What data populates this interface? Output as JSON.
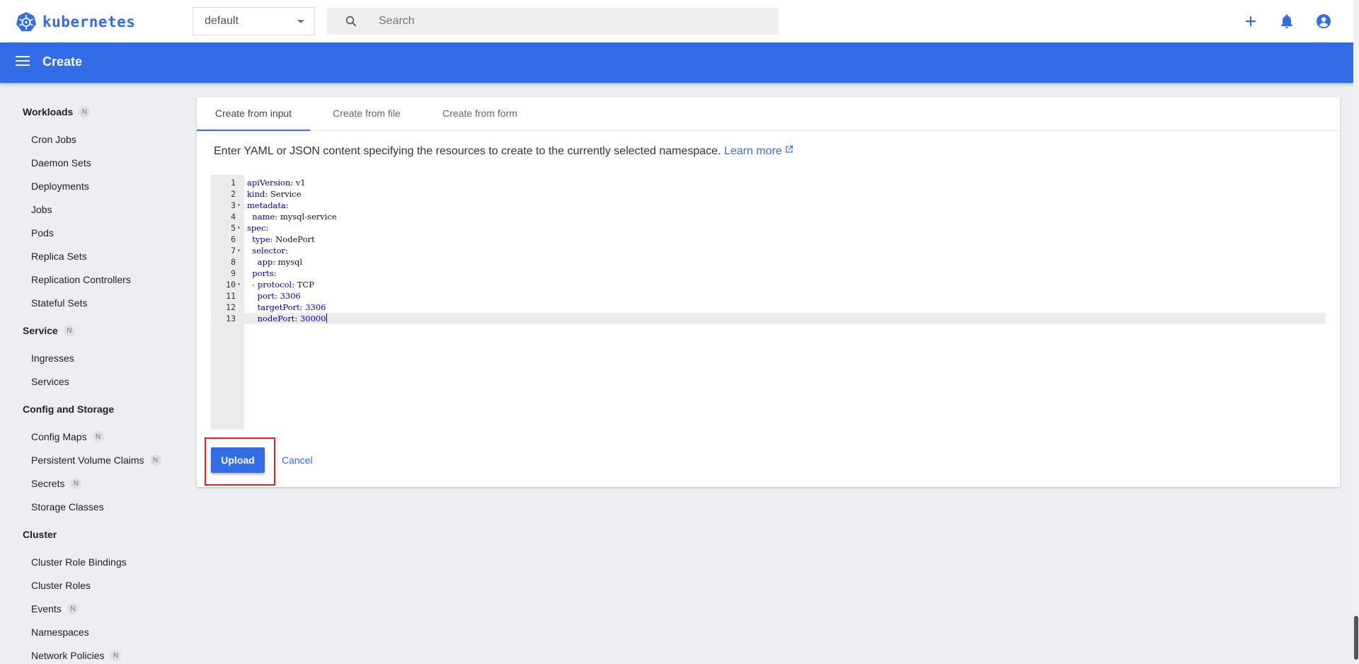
{
  "header": {
    "brand": "kubernetes",
    "namespace": "default",
    "search_placeholder": "Search"
  },
  "appbar": {
    "title": "Create"
  },
  "sidebar": {
    "groups": [
      {
        "label": "Workloads",
        "badge": "N"
      },
      {
        "label": "Service",
        "badge": "N"
      },
      {
        "label": "Config and Storage"
      },
      {
        "label": "Cluster"
      }
    ],
    "items": [
      {
        "label": "Cron Jobs"
      },
      {
        "label": "Daemon Sets"
      },
      {
        "label": "Deployments"
      },
      {
        "label": "Jobs"
      },
      {
        "label": "Pods"
      },
      {
        "label": "Replica Sets"
      },
      {
        "label": "Replication Controllers"
      },
      {
        "label": "Stateful Sets"
      },
      {
        "label": "Ingresses"
      },
      {
        "label": "Services"
      },
      {
        "label": "Config Maps",
        "badge": "N"
      },
      {
        "label": "Persistent Volume Claims",
        "badge": "N"
      },
      {
        "label": "Secrets",
        "badge": "N"
      },
      {
        "label": "Storage Classes"
      },
      {
        "label": "Cluster Role Bindings"
      },
      {
        "label": "Cluster Roles"
      },
      {
        "label": "Events",
        "badge": "N"
      },
      {
        "label": "Namespaces"
      },
      {
        "label": "Network Policies",
        "badge": "N"
      }
    ]
  },
  "tabs": [
    {
      "label": "Create from input",
      "active": true
    },
    {
      "label": "Create from file"
    },
    {
      "label": "Create from form"
    }
  ],
  "description": {
    "text": "Enter YAML or JSON content specifying the resources to create to the currently selected namespace.",
    "link": "Learn more"
  },
  "editor": {
    "lines": [
      {
        "num": "1",
        "key": "apiVersion",
        "value": "v1"
      },
      {
        "num": "2",
        "key": "kind",
        "value": "Service"
      },
      {
        "num": "3",
        "key": "metadata",
        "value": "",
        "fold": true
      },
      {
        "num": "4",
        "key": "  name",
        "value": "mysql-service"
      },
      {
        "num": "5",
        "key": "spec",
        "value": "",
        "fold": true
      },
      {
        "num": "6",
        "key": "  type",
        "value": "NodePort"
      },
      {
        "num": "7",
        "key": "  selector",
        "value": "",
        "fold": true
      },
      {
        "num": "8",
        "key": "    app",
        "value": "mysql"
      },
      {
        "num": "9",
        "key": "  ports",
        "value": ""
      },
      {
        "num": "10",
        "key": "protocol",
        "value": "TCP",
        "dash": true,
        "fold": true
      },
      {
        "num": "11",
        "key": "    port",
        "value": "3306",
        "number": true
      },
      {
        "num": "12",
        "key": "    targetPort",
        "value": "3306",
        "number": true
      },
      {
        "num": "13",
        "key": "    nodePort",
        "value": "30000",
        "number": true,
        "current": true
      }
    ]
  },
  "actions": {
    "upload": "Upload",
    "cancel": "Cancel"
  },
  "colors": {
    "brand": "#326de6",
    "highlight": "#e52222"
  }
}
